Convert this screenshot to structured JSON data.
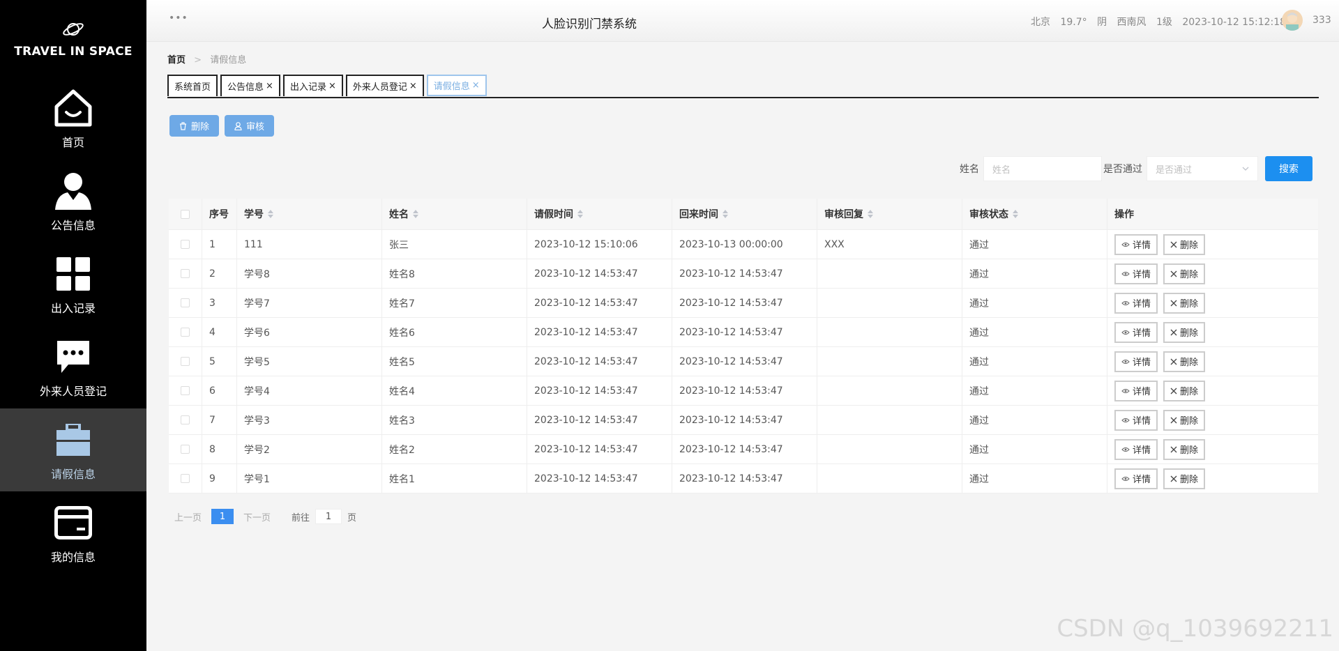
{
  "sidebar": {
    "logo_text": "TRAVEL IN SPACE",
    "items": [
      {
        "label": "首页",
        "icon": "home-icon"
      },
      {
        "label": "公告信息",
        "icon": "user-icon"
      },
      {
        "label": "出入记录",
        "icon": "grid-icon"
      },
      {
        "label": "外来人员登记",
        "icon": "chat-icon"
      },
      {
        "label": "请假信息",
        "icon": "briefcase-icon",
        "active": true
      },
      {
        "label": "我的信息",
        "icon": "card-icon"
      }
    ]
  },
  "header": {
    "more": "•••",
    "title": "人脸识别门禁系统",
    "weather": {
      "city": "北京",
      "temp": "19.7°",
      "cond": "阴",
      "wind": "西南风",
      "level": "1级",
      "datetime": "2023-10-12 15:12:18"
    },
    "username": "333"
  },
  "breadcrumb": {
    "home": "首页",
    "separator": ">",
    "current": "请假信息"
  },
  "tabs": [
    {
      "label": "系统首页",
      "closable": false
    },
    {
      "label": "公告信息",
      "closable": true
    },
    {
      "label": "出入记录",
      "closable": true
    },
    {
      "label": "外来人员登记",
      "closable": true
    },
    {
      "label": "请假信息",
      "closable": true,
      "active": true
    }
  ],
  "toolbar": {
    "delete_label": "删除",
    "audit_label": "审核"
  },
  "search": {
    "name_label": "姓名",
    "name_placeholder": "姓名",
    "pass_label": "是否通过",
    "pass_placeholder": "是否通过",
    "search_label": "搜索"
  },
  "table": {
    "columns": [
      "序号",
      "学号",
      "姓名",
      "请假时间",
      "回来时间",
      "审核回复",
      "审核状态",
      "操作"
    ],
    "detail_label": "详情",
    "delete_label": "删除",
    "rows": [
      {
        "idx": "1",
        "sid": "111",
        "name": "张三",
        "leave": "2023-10-12 15:10:06",
        "back": "2023-10-13 00:00:00",
        "reply": "XXX",
        "status": "通过"
      },
      {
        "idx": "2",
        "sid": "学号8",
        "name": "姓名8",
        "leave": "2023-10-12 14:53:47",
        "back": "2023-10-12 14:53:47",
        "reply": "",
        "status": "通过"
      },
      {
        "idx": "3",
        "sid": "学号7",
        "name": "姓名7",
        "leave": "2023-10-12 14:53:47",
        "back": "2023-10-12 14:53:47",
        "reply": "",
        "status": "通过"
      },
      {
        "idx": "4",
        "sid": "学号6",
        "name": "姓名6",
        "leave": "2023-10-12 14:53:47",
        "back": "2023-10-12 14:53:47",
        "reply": "",
        "status": "通过"
      },
      {
        "idx": "5",
        "sid": "学号5",
        "name": "姓名5",
        "leave": "2023-10-12 14:53:47",
        "back": "2023-10-12 14:53:47",
        "reply": "",
        "status": "通过"
      },
      {
        "idx": "6",
        "sid": "学号4",
        "name": "姓名4",
        "leave": "2023-10-12 14:53:47",
        "back": "2023-10-12 14:53:47",
        "reply": "",
        "status": "通过"
      },
      {
        "idx": "7",
        "sid": "学号3",
        "name": "姓名3",
        "leave": "2023-10-12 14:53:47",
        "back": "2023-10-12 14:53:47",
        "reply": "",
        "status": "通过"
      },
      {
        "idx": "8",
        "sid": "学号2",
        "name": "姓名2",
        "leave": "2023-10-12 14:53:47",
        "back": "2023-10-12 14:53:47",
        "reply": "",
        "status": "通过"
      },
      {
        "idx": "9",
        "sid": "学号1",
        "name": "姓名1",
        "leave": "2023-10-12 14:53:47",
        "back": "2023-10-12 14:53:47",
        "reply": "",
        "status": "通过"
      }
    ]
  },
  "pagination": {
    "prev": "上一页",
    "current": "1",
    "next": "下一页",
    "goto": "前往",
    "goto_value": "1",
    "unit": "页"
  },
  "watermark": "CSDN @q_1039692211",
  "colors": {
    "sidebar_bg": "#000000",
    "active_nav_bg": "#3a3a3a",
    "primary": "#1c8ff0",
    "action_button": "#6ea9e6"
  }
}
